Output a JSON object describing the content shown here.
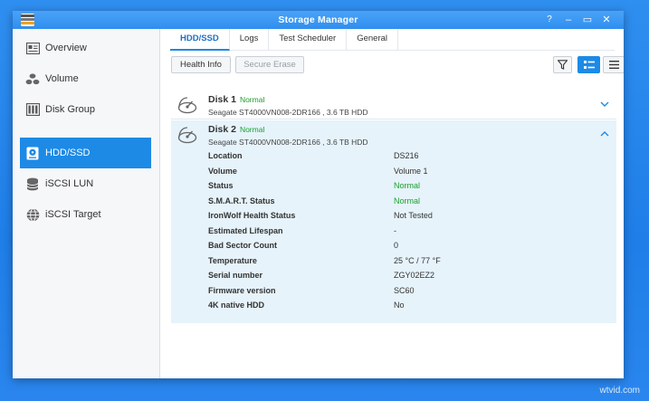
{
  "window": {
    "title": "Storage Manager",
    "controls": {
      "help": "?",
      "minimize": "–",
      "maximize": "▭",
      "close": "✕"
    }
  },
  "sidebar": {
    "items": [
      {
        "label": "Overview",
        "icon": "overview-icon",
        "active": false
      },
      {
        "label": "Volume",
        "icon": "volume-icon",
        "active": false
      },
      {
        "label": "Disk Group",
        "icon": "disk-group-icon",
        "active": false
      },
      {
        "label": "HDD/SSD",
        "icon": "hdd-icon",
        "active": true
      },
      {
        "label": "iSCSI LUN",
        "icon": "iscsi-lun-icon",
        "active": false
      },
      {
        "label": "iSCSI Target",
        "icon": "iscsi-target-icon",
        "active": false
      }
    ]
  },
  "tabs": [
    {
      "label": "HDD/SSD",
      "active": true
    },
    {
      "label": "Logs",
      "active": false
    },
    {
      "label": "Test Scheduler",
      "active": false
    },
    {
      "label": "General",
      "active": false
    }
  ],
  "toolbar": {
    "health_info": "Health Info",
    "secure_erase": "Secure Erase"
  },
  "disks": [
    {
      "name": "Disk 1",
      "status": "Normal",
      "model": "Seagate ST4000VN008-2DR166 , 3.6 TB HDD",
      "expanded": false
    },
    {
      "name": "Disk 2",
      "status": "Normal",
      "model": "Seagate ST4000VN008-2DR166 , 3.6 TB HDD",
      "expanded": true
    }
  ],
  "disk2_details": [
    {
      "label": "Location",
      "value": "DS216"
    },
    {
      "label": "Volume",
      "value": "Volume 1"
    },
    {
      "label": "Status",
      "value": "Normal"
    },
    {
      "label": "S.M.A.R.T. Status",
      "value": "Normal"
    },
    {
      "label": "IronWolf Health Status",
      "value": "Not Tested"
    },
    {
      "label": "Estimated Lifespan",
      "value": "-"
    },
    {
      "label": "Bad Sector Count",
      "value": "0"
    },
    {
      "label": "Temperature",
      "value": "25 °C / 77 °F"
    },
    {
      "label": "Serial number",
      "value": "ZGY02EZ2"
    },
    {
      "label": "Firmware version",
      "value": "SC60"
    },
    {
      "label": "4K native HDD",
      "value": "No"
    }
  ],
  "colors": {
    "accent": "#1d8ae6",
    "status_normal": "#19a12a",
    "expanded_bg": "#e6f3fb"
  },
  "watermark": "wtvid.com"
}
